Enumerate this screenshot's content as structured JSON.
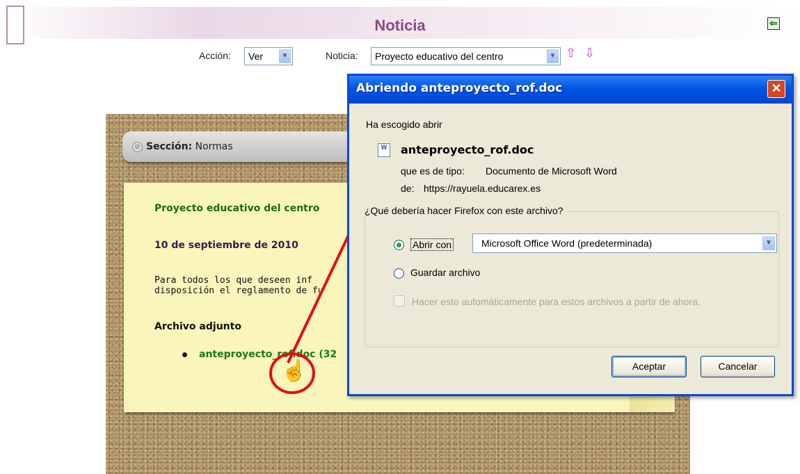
{
  "header": {
    "title": "Noticia"
  },
  "filters": {
    "accion_label": "Acción:",
    "accion_value": "Ver",
    "noticia_label": "Noticia:",
    "noticia_value": "Proyecto educativo del centro"
  },
  "board": {
    "section_label": "Sección:",
    "section_value": "Normas",
    "note_title": "Proyecto educativo del centro",
    "date": "10 de septiembre de 2010",
    "body_line1": "Para todos los que deseen inf",
    "body_line2": "disposición el reglamento de fu",
    "attachment_heading": "Archivo adjunto",
    "attachment_item": "anteproyecto_rof.doc (32"
  },
  "dialog": {
    "title": "Abriendo anteproyecto_rof.doc",
    "intro": "Ha escogido abrir",
    "filename": "anteproyecto_rof.doc",
    "type_label": "que es de tipo:",
    "type_value": "Documento de Microsoft Word",
    "from_label": "de:",
    "from_value": "https://rayuela.educarex.es",
    "question": "¿Qué debería hacer Firefox con este archivo?",
    "open_with_label": "Abrir con",
    "open_with_app": "Microsoft Office Word (predeterminada)",
    "save_label": "Guardar archivo",
    "auto_label": "Hacer esto automáticamente para estos archivos a partir de ahora.",
    "accept": "Aceptar",
    "cancel": "Cancelar"
  },
  "colors": {
    "accent_title": "#8a4a86",
    "dialog_blue": "#0055e5",
    "annotation_red": "#e21010"
  },
  "icons": [
    "back-arrow-icon",
    "dropdown-arrow-icon",
    "up-arrow-icon",
    "down-arrow-icon",
    "section-icon",
    "word-document-icon",
    "close-icon",
    "hand-cursor-icon"
  ]
}
